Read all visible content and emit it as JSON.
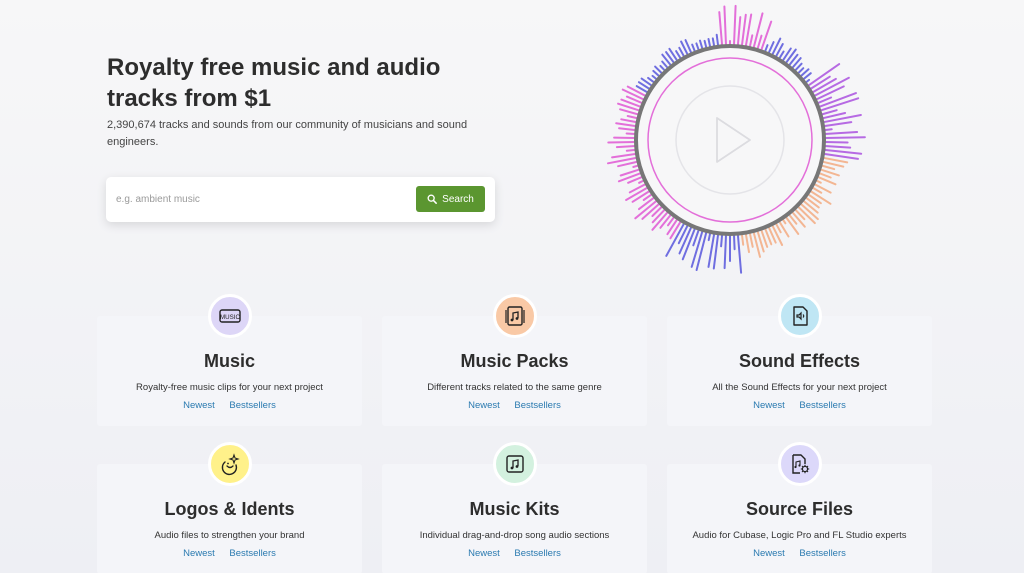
{
  "hero": {
    "title": "Royalty free music and audio tracks from $1",
    "subtitle": "2,390,674 tracks and sounds from our community of musicians and sound engineers."
  },
  "search": {
    "placeholder": "e.g. ambient music",
    "button_label": "Search",
    "button_color": "#5b9630"
  },
  "player": {
    "icon": "play-icon",
    "colors": {
      "violet": "#6f6ee0",
      "magenta": "#e36fd9",
      "peach": "#f3b693",
      "purple": "#b66ae3",
      "ring": "#777777"
    }
  },
  "categories": [
    {
      "title": "Music",
      "description": "Royalty-free music clips for your next project",
      "icon": "music-label-icon",
      "icon_bg": "#ddd6f7",
      "links": [
        "Newest",
        "Bestsellers"
      ]
    },
    {
      "title": "Music Packs",
      "description": "Different tracks related to the same genre",
      "icon": "music-pack-icon",
      "icon_bg": "#f9c9a6",
      "links": [
        "Newest",
        "Bestsellers"
      ]
    },
    {
      "title": "Sound Effects",
      "description": "All the Sound Effects for your next project",
      "icon": "sound-file-icon",
      "icon_bg": "#bfe6f4",
      "links": [
        "Newest",
        "Bestsellers"
      ]
    },
    {
      "title": "Logos & Idents",
      "description": "Audio files to strengthen your brand",
      "icon": "sparkle-icon",
      "icon_bg": "#fff18a",
      "links": [
        "Newest",
        "Bestsellers"
      ]
    },
    {
      "title": "Music Kits",
      "description": "Individual drag-and-drop song audio sections",
      "icon": "music-note-icon",
      "icon_bg": "#d3f1df",
      "links": [
        "Newest",
        "Bestsellers"
      ]
    },
    {
      "title": "Source Files",
      "description": "Audio for Cubase, Logic Pro and FL Studio experts",
      "icon": "source-file-icon",
      "icon_bg": "#dcd8fa",
      "links": [
        "Newest",
        "Bestsellers"
      ]
    }
  ]
}
